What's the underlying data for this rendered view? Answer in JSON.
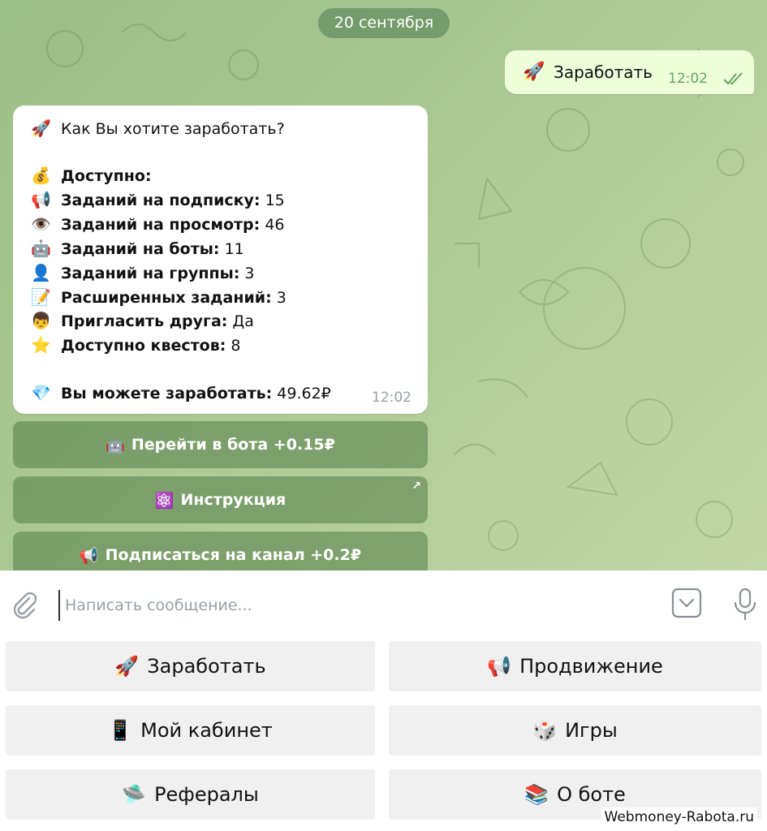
{
  "date_pill": "20 сентября",
  "outgoing": {
    "emoji": "🚀",
    "text": "Заработать",
    "time": "12:02"
  },
  "incoming": {
    "title_emoji": "🚀",
    "title": "Как Вы хотите заработать?",
    "available_emoji": "💰",
    "available_label": "Доступно:",
    "stats": [
      {
        "emoji": "📢",
        "label": "Заданий на подписку:",
        "value": "15"
      },
      {
        "emoji": "👁️",
        "label": "Заданий на просмотр:",
        "value": "46"
      },
      {
        "emoji": "🤖",
        "label": "Заданий на боты:",
        "value": "11"
      },
      {
        "emoji": "👤",
        "label": "Заданий на группы:",
        "value": "3"
      },
      {
        "emoji": "📝",
        "label": "Расширенных заданий:",
        "value": "3"
      },
      {
        "emoji": "👦",
        "label": "Пригласить друга:",
        "value": "Да"
      },
      {
        "emoji": "⭐",
        "label": "Доступно квестов:",
        "value": "8"
      }
    ],
    "earn_emoji": "💎",
    "earn_label": "Вы можете заработать:",
    "earn_value": "49.62₽",
    "time": "12:02"
  },
  "inline_buttons": [
    {
      "emoji": "🤖",
      "label": "Перейти в бота +0.15₽"
    },
    {
      "emoji": "⚛️",
      "label": "Инструкция"
    },
    {
      "emoji": "📢",
      "label": "Подписаться на канал +0.2₽"
    }
  ],
  "composer": {
    "placeholder": "Написать сообщение..."
  },
  "keyboard": [
    {
      "emoji": "🚀",
      "label": "Заработать"
    },
    {
      "emoji": "📢",
      "label": "Продвижение"
    },
    {
      "emoji": "📱",
      "label": "Мой кабинет"
    },
    {
      "emoji": "🎲",
      "label": "Игры"
    },
    {
      "emoji": "🛸",
      "label": "Рефералы"
    },
    {
      "emoji": "📚",
      "label": "О боте"
    }
  ],
  "watermark": "Webmoney-Rabota.ru",
  "colors": {
    "chat_bg": "#a8c690",
    "outgoing_bubble": "#eefed9",
    "check_green": "#5fa860",
    "inline_button": "#6f9060"
  }
}
